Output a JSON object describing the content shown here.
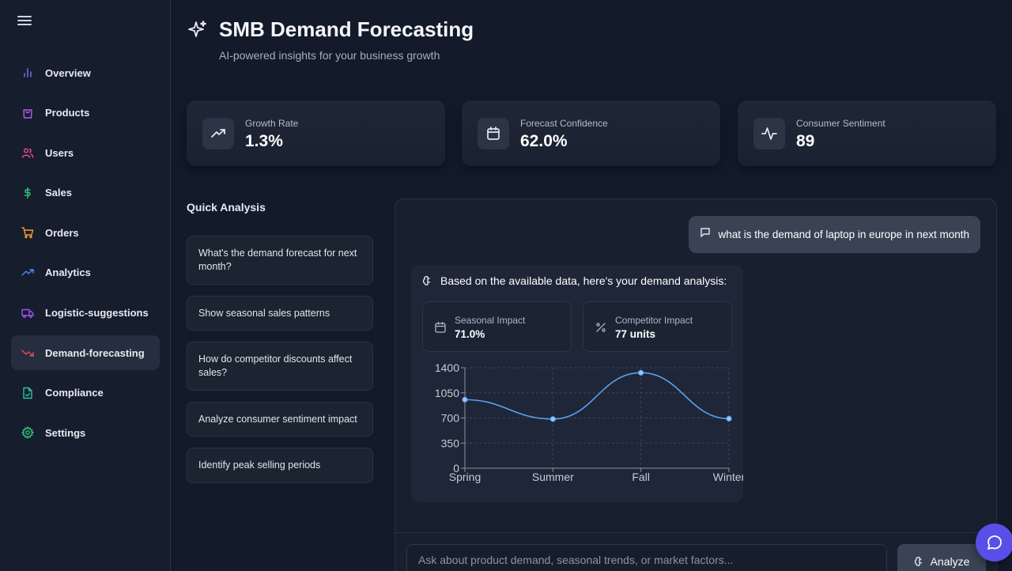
{
  "sidebar": {
    "items": [
      {
        "label": "Overview",
        "icon": "bar-chart-icon",
        "color": "#6b7cf5"
      },
      {
        "label": "Products",
        "icon": "shopping-bag-icon",
        "color": "#b15cf0"
      },
      {
        "label": "Users",
        "icon": "users-icon",
        "color": "#ec4f8f"
      },
      {
        "label": "Sales",
        "icon": "dollar-icon",
        "color": "#2fc07a"
      },
      {
        "label": "Orders",
        "icon": "shopping-cart-icon",
        "color": "#f59e2e"
      },
      {
        "label": "Analytics",
        "icon": "trending-up-icon",
        "color": "#4d8df5"
      },
      {
        "label": "Logistic-suggestions",
        "icon": "truck-icon",
        "color": "#a04ff0"
      },
      {
        "label": "Demand-forecasting",
        "icon": "trending-down-icon",
        "color": "#ef4a5a"
      },
      {
        "label": "Compliance",
        "icon": "file-check-icon",
        "color": "#2fc0a0"
      },
      {
        "label": "Settings",
        "icon": "gear-icon",
        "color": "#2fc07a"
      }
    ],
    "active": "Demand-forecasting"
  },
  "header": {
    "title": "SMB Demand Forecasting",
    "subtitle": "AI-powered insights for your business growth"
  },
  "stats": [
    {
      "label": "Growth Rate",
      "value": "1.3%",
      "icon": "trending-up-icon"
    },
    {
      "label": "Forecast Confidence",
      "value": "62.0%",
      "icon": "calendar-icon"
    },
    {
      "label": "Consumer Sentiment",
      "value": "89",
      "icon": "activity-icon"
    }
  ],
  "quick_analysis": {
    "title": "Quick Analysis",
    "items": [
      "What's the demand forecast for next month?",
      "Show seasonal sales patterns",
      "How do competitor discounts affect sales?",
      "Analyze consumer sentiment impact",
      "Identify peak selling periods"
    ]
  },
  "chat": {
    "user_message": "what is the demand of laptop in europe in next month",
    "ai_header": "Based on the available data, here's your demand analysis:",
    "impacts": [
      {
        "label": "Seasonal Impact",
        "value": "71.0%",
        "icon": "calendar-icon"
      },
      {
        "label": "Competitor Impact",
        "value": "77 units",
        "icon": "percent-icon"
      }
    ],
    "input_placeholder": "Ask about product demand, seasonal trends, or market factors...",
    "analyze_label": "Analyze"
  },
  "chart_data": {
    "type": "line",
    "categories": [
      "Spring",
      "Summer",
      "Fall",
      "Winter"
    ],
    "values": [
      955,
      685,
      1330,
      690
    ],
    "ylim": [
      0,
      1400
    ],
    "yticks": [
      0,
      350,
      700,
      1050,
      1400
    ],
    "xlabel": "",
    "ylabel": "",
    "grid": true,
    "line_color": "#5aa0f0"
  }
}
